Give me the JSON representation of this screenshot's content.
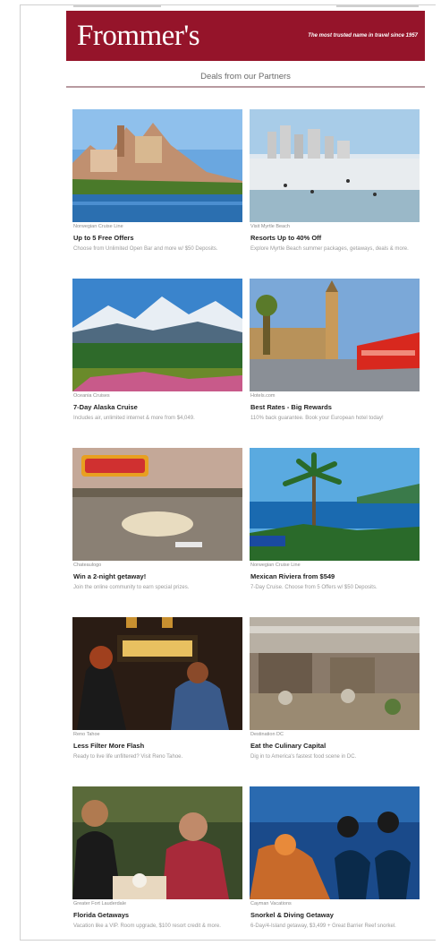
{
  "header": {
    "logo": "Frommer's",
    "tagline": "The most trusted name in travel since 1957"
  },
  "section_title": "Deals from our Partners",
  "deals": [
    {
      "partner": "Norwegian Cruise Line",
      "title": "Up to 5 Free Offers",
      "desc": "Choose from Unlimited Open Bar and more w/ $50 Deposits."
    },
    {
      "partner": "Visit Myrtle Beach",
      "title": "Resorts Up to 40% Off",
      "desc": "Explore Myrtle Beach summer packages, getaways, deals & more."
    },
    {
      "partner": "Oceania Cruises",
      "title": "7-Day Alaska Cruise",
      "desc": "Includes air, unlimited internet & more from $4,049."
    },
    {
      "partner": "Hotels.com",
      "title": "Best Rates - Big Rewards",
      "desc": "110% back guarantee. Book your European hotel today!"
    },
    {
      "partner": "Chateaulogo",
      "title": "Win a 2-night getaway!",
      "desc": "Join the online community to earn special prizes."
    },
    {
      "partner": "Norwegian Cruise Line",
      "title": "Mexican Riviera from $549",
      "desc": "7-Day Cruise. Choose from 5 Offers w/ $50 Deposits."
    },
    {
      "partner": "Reno Tahoe",
      "title": "Less Filter More Flash",
      "desc": "Ready to live life unfiltered? Visit Reno Tahoe."
    },
    {
      "partner": "Destination DC",
      "title": "Eat the Culinary Capital",
      "desc": "Dig in to America's fastest food scene in DC."
    },
    {
      "partner": "Greater Fort Lauderdale",
      "title": "Florida Getaways",
      "desc": "Vacation like a VIP. Room upgrade, $100 resort credit & more."
    },
    {
      "partner": "Cayman Vacations",
      "title": "Snorkel & Diving Getaway",
      "desc": "6-Day/4-Island getaway, $3,499 + Great Barrier Reef snorkel."
    }
  ],
  "image_icons": [
    "town-on-river-photo",
    "beach-city-photo",
    "alaska-mountains-photo",
    "london-big-ben-photo",
    "river-boat-sign-photo",
    "palm-tree-coast-photo",
    "reno-bar-couple-photo",
    "street-cafe-photo",
    "friends-dining-photo",
    "scuba-divers-photo"
  ],
  "colors": {
    "brand": "#95142a",
    "divider": "#b89aa0"
  }
}
